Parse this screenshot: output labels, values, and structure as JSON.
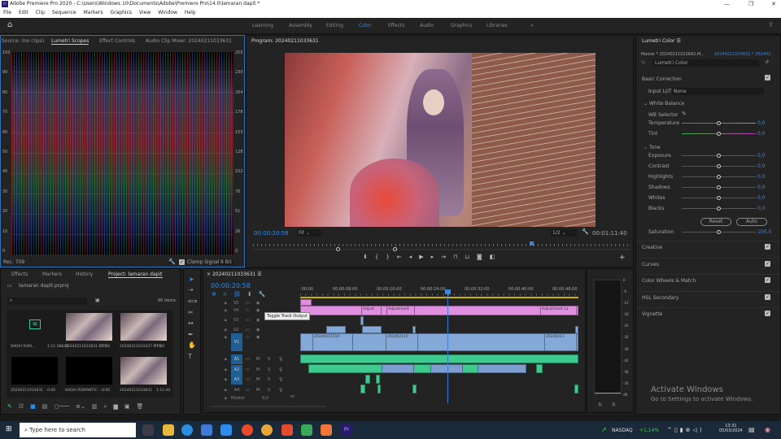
{
  "window": {
    "title": "Adobe Premiere Pro 2020 - C:\\Users\\Windows 10\\Documents\\Adobe\\Premiere Pro\\14.0\\lamaran dapit *",
    "app_icon": "Pr"
  },
  "menu": [
    "File",
    "Edit",
    "Clip",
    "Sequence",
    "Markers",
    "Graphics",
    "View",
    "Window",
    "Help"
  ],
  "workspaces": [
    "Learning",
    "Assembly",
    "Editing",
    "Color",
    "Effects",
    "Audio",
    "Graphics",
    "Libraries"
  ],
  "workspace_active": "Color",
  "more": "»",
  "scopes": {
    "tabs": [
      "Source: (no clips)",
      "Lumetri Scopes",
      "Effect Controls",
      "Audio Clip Mixer: 20240211033631"
    ],
    "left_axis": [
      "100",
      "90",
      "80",
      "70",
      "60",
      "50",
      "40",
      "30",
      "20",
      "10",
      "0"
    ],
    "right_axis": [
      "255",
      "230",
      "204",
      "178",
      "153",
      "128",
      "102",
      "76",
      "51",
      "26",
      "0"
    ],
    "standard": "Rec. 709",
    "clamp": "Clamp Signal",
    "bits": "8 Bit"
  },
  "program": {
    "title": "Program: 20240211033631",
    "timecode": "00:00:20:58",
    "fit": "Fit",
    "resolution": "1/2",
    "duration": "00:01:11:40",
    "playhead_fraction": 0.735
  },
  "lumetri": {
    "title": "Lumetri Color",
    "master": "Master * 20240211022642.M...",
    "sequence": "20240211033631 * 202402...",
    "effect": "Lumetri Color",
    "basic": "Basic Correction",
    "input_lut_label": "Input LUT",
    "input_lut": "None",
    "white_balance": "White Balance",
    "wb_selector": "WB Selector",
    "tone": "Tone",
    "params": [
      {
        "name": "Temperature",
        "value": "0,0"
      },
      {
        "name": "Tint",
        "value": "0,0"
      },
      {
        "name": "Exposure",
        "value": "0,0"
      },
      {
        "name": "Contrast",
        "value": "0,0"
      },
      {
        "name": "Highlights",
        "value": "0,0"
      },
      {
        "name": "Shadows",
        "value": "0,0"
      },
      {
        "name": "Whites",
        "value": "0,0"
      },
      {
        "name": "Blacks",
        "value": "0,0"
      }
    ],
    "reset": "Reset",
    "auto": "Auto",
    "saturation_label": "Saturation",
    "saturation": "100,0",
    "sections": [
      "Creative",
      "Curves",
      "Color Wheels & Match",
      "HSL Secondary",
      "Vignette"
    ]
  },
  "activate": {
    "title": "Activate Windows",
    "sub": "Go to Settings to activate Windows."
  },
  "project": {
    "tabs": [
      "Effects",
      "Markers",
      "History",
      "Project: lamaran dapit"
    ],
    "file": "lamaran dapit.prproj",
    "count": "66 items",
    "items": [
      {
        "name": "BADAI ROM...",
        "dur": "1:11:38643"
      },
      {
        "name": "20240211033631.MTS",
        "dur": "1:06"
      },
      {
        "name": "20240211033437.MTS",
        "dur": "7:00"
      },
      {
        "name": "20240211033631",
        "dur": "0:00"
      },
      {
        "name": "BADAI ROMANTIC -...",
        "dur": "0:00"
      },
      {
        "name": "20240211033631",
        "dur": "1:11:40"
      }
    ]
  },
  "timeline": {
    "title": "20240211033631",
    "timecode": "00:00:20:58",
    "ruler": [
      ":00:00",
      "00:00:08:00",
      "00:00:16:00",
      "00:00:24:00",
      "00:00:32:00",
      "00:00:40:00",
      "00:00:48:00"
    ],
    "video_tracks": [
      "V5",
      "V4",
      "V3",
      "V2",
      "V1"
    ],
    "audio_tracks": [
      "A1",
      "A2",
      "A3",
      "A4"
    ],
    "master": "Master",
    "master_val": "0,0",
    "tooltip": "Toggle Track Output",
    "clips": {
      "adj1": "Adjust",
      "adj2": "Adjustment",
      "adj3": "Adjustment La",
      "v1a": "20240211014",
      "v1b": "202402110",
      "v1c": "20240211"
    },
    "m": "M",
    "s": "S"
  },
  "meter": {
    "scale": [
      "0",
      "-6",
      "-12",
      "-18",
      "-24",
      "-30",
      "-36",
      "-42",
      "-48",
      "-54",
      "dB"
    ],
    "solo": "S"
  },
  "taskbar": {
    "search": "Type here to search",
    "stock": "NASDAQ",
    "change": "+1,14%",
    "time": "13:31",
    "date": "05/03/2024"
  }
}
